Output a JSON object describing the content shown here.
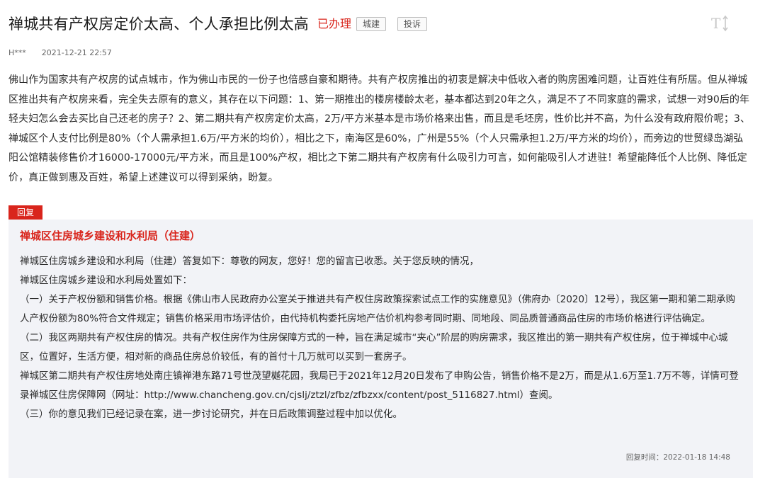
{
  "header": {
    "title": "禅城共有产权房定价太高、个人承担比例太高",
    "status": "已办理",
    "tags": [
      "城建",
      "投诉"
    ]
  },
  "meta": {
    "author": "H***",
    "date": "2021-12-21 22:57"
  },
  "post": {
    "body": "佛山作为国家共有产权房的试点城市，作为佛山市民的一份子也倍感自豪和期待。共有产权房推出的初衷是解决中低收入者的购房困难问题，让百姓住有所居。但从禅城区推出共有产权房来看，完全失去原有的意义，其存在以下问题：1、第一期推出的楼房楼龄太老，基本都达到20年之久，满足不了不同家庭的需求，试想一对90后的年轻夫妇怎么会去买比自己还老的房子？2、第二期共有产权房定价太高，2万/平方米基本是市场价格来出售，而且是毛坯房，性价比并不高，为什么没有政府限价呢；3、禅城区个人支付比例是80%（个人需承担1.6万/平方米的均价），相比之下，南海区是60%，广州是55%（个人只需承担1.2万/平方米的均价），而旁边的世贸绿岛湖弘阳公馆精装修售价才16000-17000元/平方米，而且是100%产权，相比之下第二期共有产权房有什么吸引力可言，如何能吸引人才进驻！希望能降低个人比例、降低定价，真正做到惠及百姓，希望上述建议可以得到采纳，盼复。"
  },
  "reply": {
    "badge": "回复",
    "department": "禅城区住房城乡建设和水利局（住建）",
    "paragraphs": [
      "禅城区住房城乡建设和水利局（住建）答复如下：尊敬的网友，您好！您的留言已收悉。关于您反映的情况，禅城区住房城乡建设和水利局处置如下：",
      "（一）关于产权份额和销售价格。根据《佛山市人民政府办公室关于推进共有产权住房政策探索试点工作的实施意见》（佛府办〔2020〕12号），我区第一期和第二期承购人产权份额为80%符合文件规定；销售价格采用市场评估价，由代持机构委托房地产估价机构参考同时期、同地段、同品质普通商品住房的市场价格进行评估确定。",
      "（二）我区两期共有产权住房的情况。共有产权住房作为住房保障方式的一种，旨在满足城市“夹心”阶层的购房需求，我区推出的第一期共有产权住房，位于禅城中心城区，位置好，生活方便，相对新的商品住房总价较低，有的首付十几万就可以买到一套房子。",
      "禅城区第二期共有产权住房地处南庄镇禅港东路71号世茂望樾花园，我局已于2021年12月20日发布了申购公告，销售价格不是2万，而是从1.6万至1.7万不等，详情可登录禅城区住房保障网（网址：http://www.chancheng.gov.cn/cjslj/ztzl/zfbz/zfbzxx/content/post_5116827.html）查阅。",
      "（三）你的意见我们已经记录在案，进一步讨论研究，并在日后政策调整过程中加以优化。"
    ],
    "time_label": "回复时间：2022-01-18 14:48"
  },
  "icons": {
    "font_size": "font-size-toggle-icon"
  }
}
